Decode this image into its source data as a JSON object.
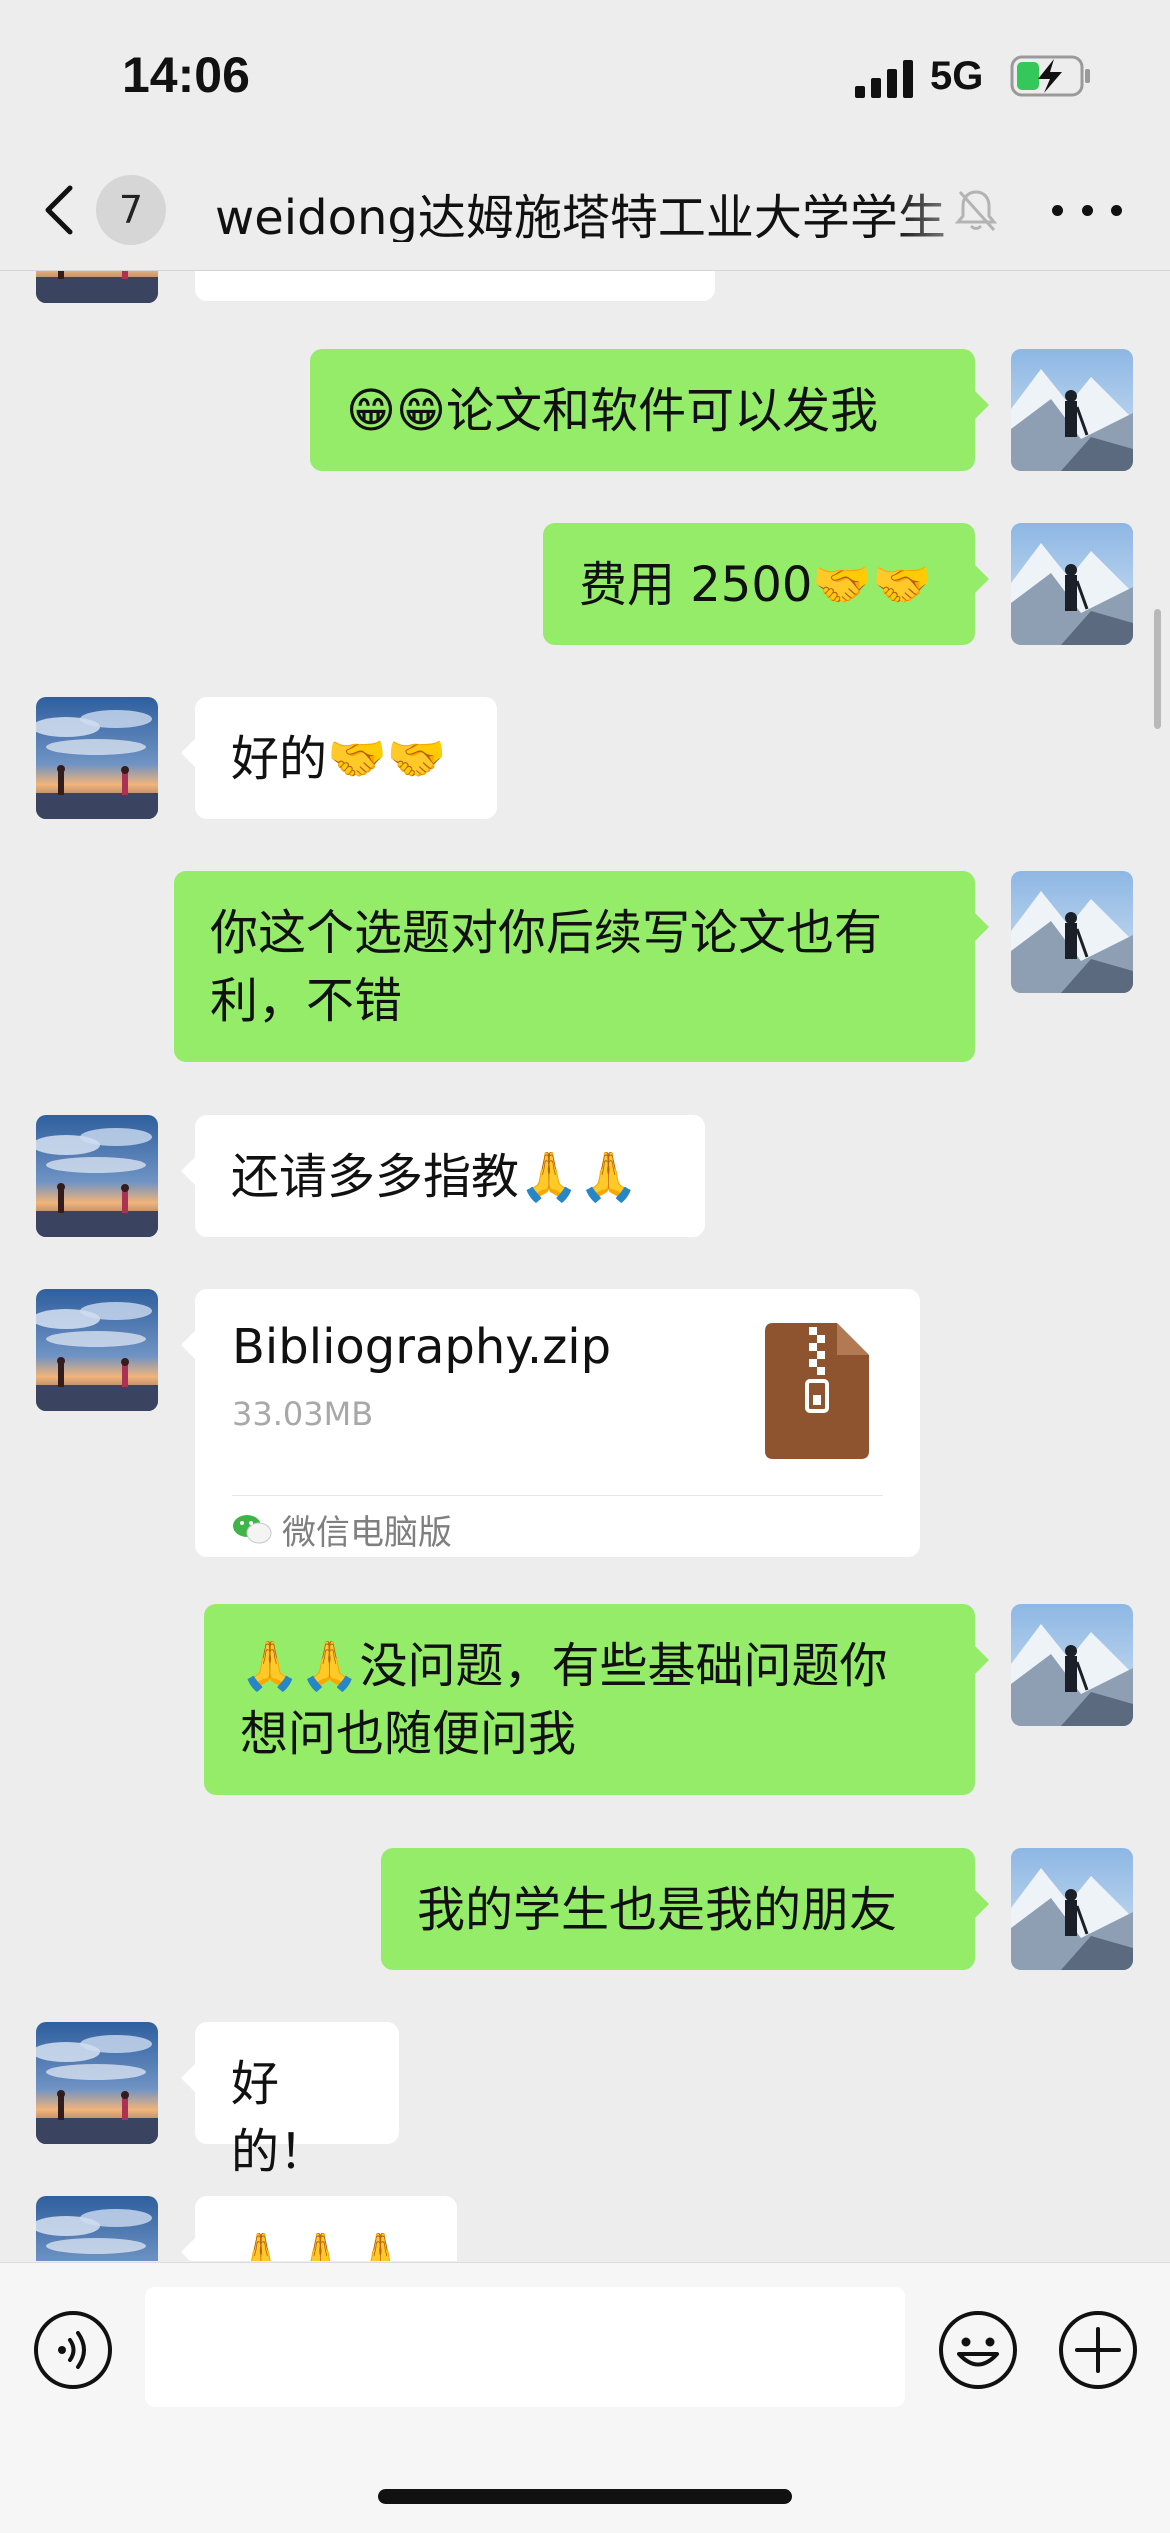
{
  "status_bar": {
    "time": "14:06",
    "network": "5G"
  },
  "nav": {
    "unread_count": "7",
    "title": "weidong达姆施塔特工业大学学生"
  },
  "messages": [
    {
      "dir": "out",
      "text": "😁😁论文和软件可以发我"
    },
    {
      "dir": "out",
      "text": "费用 2500🤝🤝"
    },
    {
      "dir": "in",
      "text": "好的🤝🤝"
    },
    {
      "dir": "out",
      "line1": "你这个选题对你后续写论文也有",
      "line2": "利，不错"
    },
    {
      "dir": "in",
      "text": "还请多多指教🙏🙏"
    },
    {
      "dir": "in",
      "type": "file",
      "file_name": "Bibliography.zip",
      "file_size": "33.03MB",
      "source": "微信电脑版"
    },
    {
      "dir": "out",
      "line1": "🙏🙏没问题，有些基础问题你",
      "line2": "想问也随便问我"
    },
    {
      "dir": "out",
      "text": "我的学生也是我的朋友"
    },
    {
      "dir": "in",
      "text": "好的！"
    },
    {
      "dir": "in",
      "text": "🙏🙏🙏"
    }
  ],
  "input": {
    "placeholder": ""
  },
  "icons": {
    "back": "chevron-left-icon",
    "mute": "bell-slash-icon",
    "more": "more-horizontal-icon",
    "voice": "voice-icon",
    "emoji": "smiley-icon",
    "plus": "plus-icon",
    "file": "zip-file-icon"
  },
  "colors": {
    "outgoing_bubble": "#95ec69",
    "incoming_bubble": "#ffffff",
    "background": "#ededed",
    "zip_icon": "#8e5430"
  }
}
